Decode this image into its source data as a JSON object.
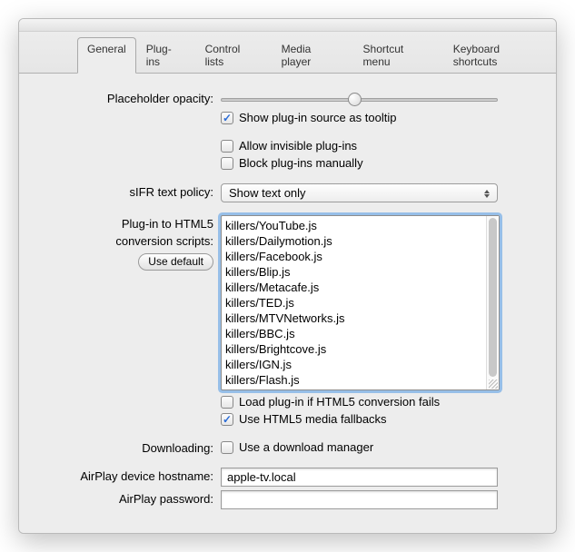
{
  "tabs": {
    "general": "General",
    "plugins": "Plug-ins",
    "controlLists": "Control lists",
    "mediaPlayer": "Media player",
    "shortcutMenu": "Shortcut menu",
    "keyboardShortcuts": "Keyboard shortcuts"
  },
  "labels": {
    "placeholderOpacity": "Placeholder opacity:",
    "sifrPolicy": "sIFR text policy:",
    "conversionScripts": "Plug-in to HTML5",
    "conversionScripts2": "conversion scripts:",
    "downloading": "Downloading:",
    "airplayHost": "AirPlay device hostname:",
    "airplayPass": "AirPlay password:"
  },
  "checkboxes": {
    "showSourceTooltip": "Show plug-in source as tooltip",
    "allowInvisible": "Allow invisible plug-ins",
    "blockManually": "Block plug-ins manually",
    "loadIfFails": "Load plug-in if HTML5 conversion fails",
    "useFallbacks": "Use HTML5 media fallbacks",
    "useDownloadMgr": "Use a download manager"
  },
  "buttons": {
    "useDefault": "Use default"
  },
  "select": {
    "sifrValue": "Show text only"
  },
  "scripts": "killers/YouTube.js\nkillers/Dailymotion.js\nkillers/Facebook.js\nkillers/Blip.js\nkillers/Metacafe.js\nkillers/TED.js\nkillers/MTVNetworks.js\nkillers/BBC.js\nkillers/Brightcove.js\nkillers/IGN.js\nkillers/Flash.js",
  "inputs": {
    "airplayHost": "apple-tv.local",
    "airplayPass": ""
  }
}
